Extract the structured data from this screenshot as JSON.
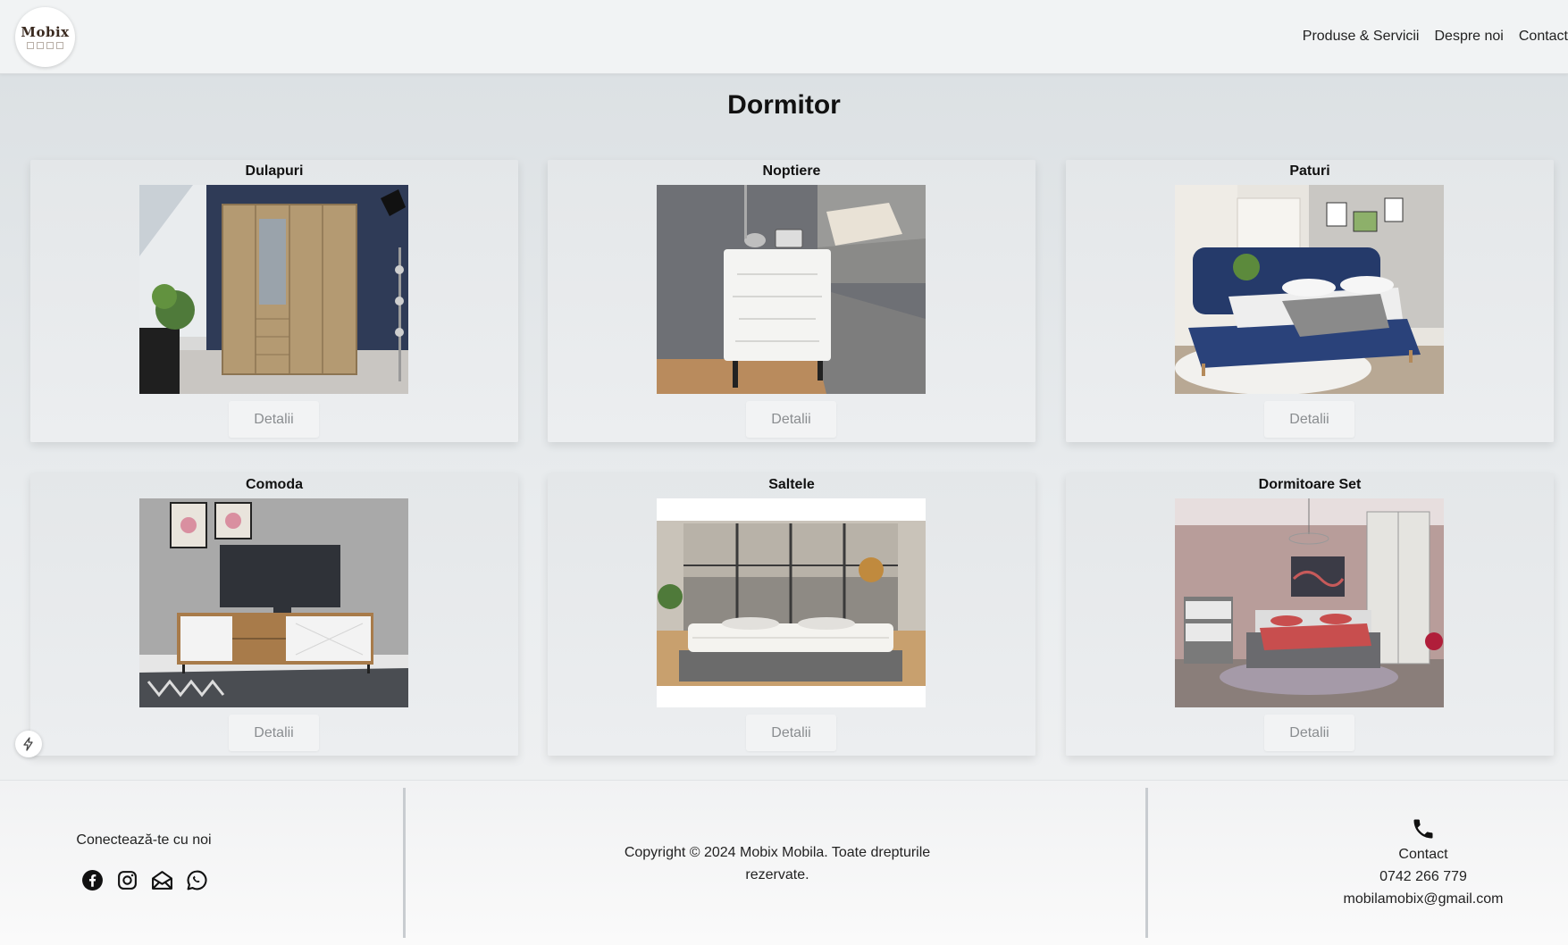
{
  "header": {
    "logo_text": "Mobix",
    "nav": [
      "Produse & Servicii",
      "Despre noi",
      "Contact"
    ]
  },
  "page": {
    "title": "Dormitor"
  },
  "categories": [
    {
      "title": "Dulapuri",
      "button": "Detalii",
      "image": "wardrobe-photo"
    },
    {
      "title": "Noptiere",
      "button": "Detalii",
      "image": "nightstand-photo"
    },
    {
      "title": "Paturi",
      "button": "Detalii",
      "image": "bed-photo"
    },
    {
      "title": "Comoda",
      "button": "Detalii",
      "image": "tv-stand-photo"
    },
    {
      "title": "Saltele",
      "button": "Detalii",
      "image": "mattress-photo"
    },
    {
      "title": "Dormitoare Set",
      "button": "Detalii",
      "image": "bedroom-set-photo"
    }
  ],
  "footer": {
    "connect_label": "Conectează-te cu noi",
    "social_icons": [
      "facebook-icon",
      "instagram-icon",
      "email-icon",
      "whatsapp-icon"
    ],
    "copyright": "Copyright © 2024 Mobix Mobila. Toate drepturile rezervate.",
    "contact": {
      "heading": "Contact",
      "phone": "0742 266 779",
      "email": "mobilamobix@gmail.com"
    }
  },
  "colors": {
    "button_text": "#8a8d90",
    "background": "#dadfe2",
    "card": "#e6e9eb"
  }
}
